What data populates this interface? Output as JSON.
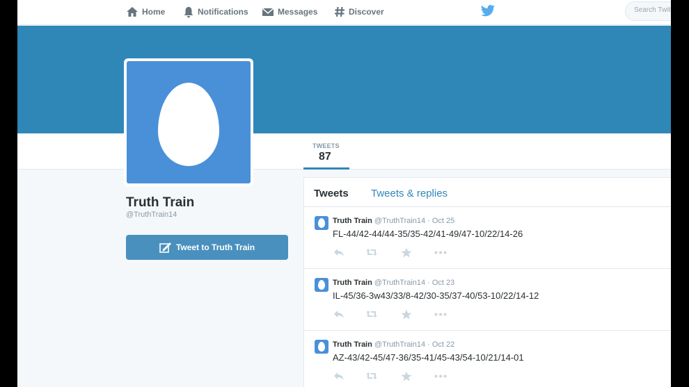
{
  "nav": {
    "home": "Home",
    "notifications": "Notifications",
    "messages": "Messages",
    "discover": "Discover",
    "search_placeholder": "Search Twitter"
  },
  "profile": {
    "name": "Truth Train",
    "handle": "@TruthTrain14",
    "tweet_to_label": "Tweet to Truth Train"
  },
  "stats": {
    "tweets_label": "TWEETS",
    "tweets_value": "87"
  },
  "timeline": {
    "tab_tweets": "Tweets",
    "tab_replies": "Tweets & replies",
    "tweets": [
      {
        "name": "Truth Train",
        "handle": "@TruthTrain14",
        "sep": "·",
        "date": "Oct 25",
        "text": "FL-44/42-44/44-35/35-42/41-49/47-10/22/14-26"
      },
      {
        "name": "Truth Train",
        "handle": "@TruthTrain14",
        "sep": "·",
        "date": "Oct 23",
        "text": "IL-45/36-3w43/33/8-42/30-35/37-40/53-10/22/14-12"
      },
      {
        "name": "Truth Train",
        "handle": "@TruthTrain14",
        "sep": "·",
        "date": "Oct 22",
        "text": "AZ-43/42-45/47-36/35-41/45-43/54-10/21/14-01"
      }
    ]
  },
  "colors": {
    "banner": "#2f87b7",
    "avatar": "#4a90d9",
    "accent": "#2f87b7"
  }
}
